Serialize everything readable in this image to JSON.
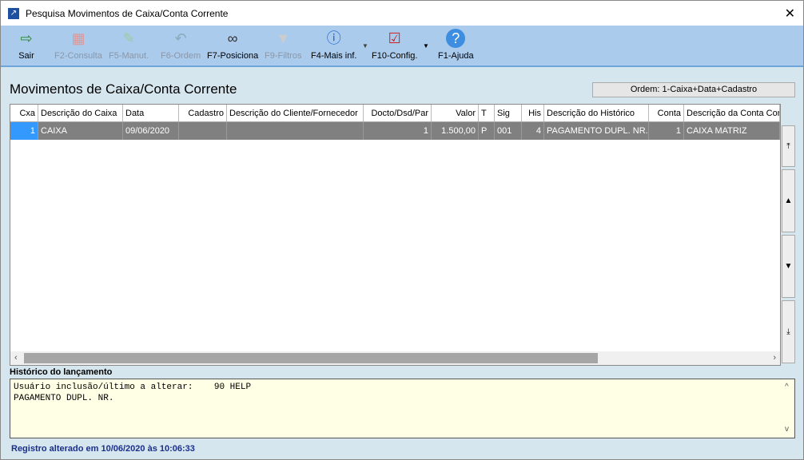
{
  "window": {
    "title": "Pesquisa Movimentos de Caixa/Conta Corrente",
    "close": "✕"
  },
  "toolbar": [
    {
      "label": "Sair",
      "icon": "exit-door-icon",
      "enabled": true
    },
    {
      "label": "F2-Consulta",
      "icon": "consulta-icon",
      "enabled": false
    },
    {
      "label": "F5-Manut.",
      "icon": "edit-icon",
      "enabled": false
    },
    {
      "label": "F6-Ordem",
      "icon": "undo-icon",
      "enabled": false
    },
    {
      "label": "F7-Posiciona",
      "icon": "binoculars-icon",
      "enabled": true
    },
    {
      "label": "F9-Filtros",
      "icon": "filter-icon",
      "enabled": false
    },
    {
      "label": "F4-Mais inf.",
      "icon": "info-icon",
      "enabled": true
    },
    {
      "label": "F10-Config.",
      "icon": "checklist-icon",
      "enabled": true
    },
    {
      "label": "F1-Ajuda",
      "icon": "help-icon",
      "enabled": true
    }
  ],
  "heading": "Movimentos de Caixa/Conta Corrente",
  "order": "Ordem: 1-Caixa+Data+Cadastro",
  "table": {
    "columns": [
      "Cxa",
      "Descrição do Caixa",
      "Data",
      "Cadastro",
      "Descrição do Cliente/Fornecedor",
      "Docto/Dsd/Par",
      "Valor",
      "T",
      "Sig",
      "His",
      "Descrição do Histórico",
      "Conta",
      "Descrição da Conta Con"
    ],
    "rows": [
      [
        "1",
        "CAIXA",
        "09/06/2020",
        "",
        "",
        "1",
        "1.500,00",
        "P",
        "001",
        "4",
        "PAGAMENTO DUPL. NR.",
        "1",
        "CAIXA MATRIZ"
      ]
    ]
  },
  "history": {
    "label": "Histórico do lançamento",
    "text": "Usuário inclusão/último a alterar:    90 HELP\nPAGAMENTO DUPL. NR."
  },
  "status": "Registro alterado em 10/06/2020 às 10:06:33"
}
